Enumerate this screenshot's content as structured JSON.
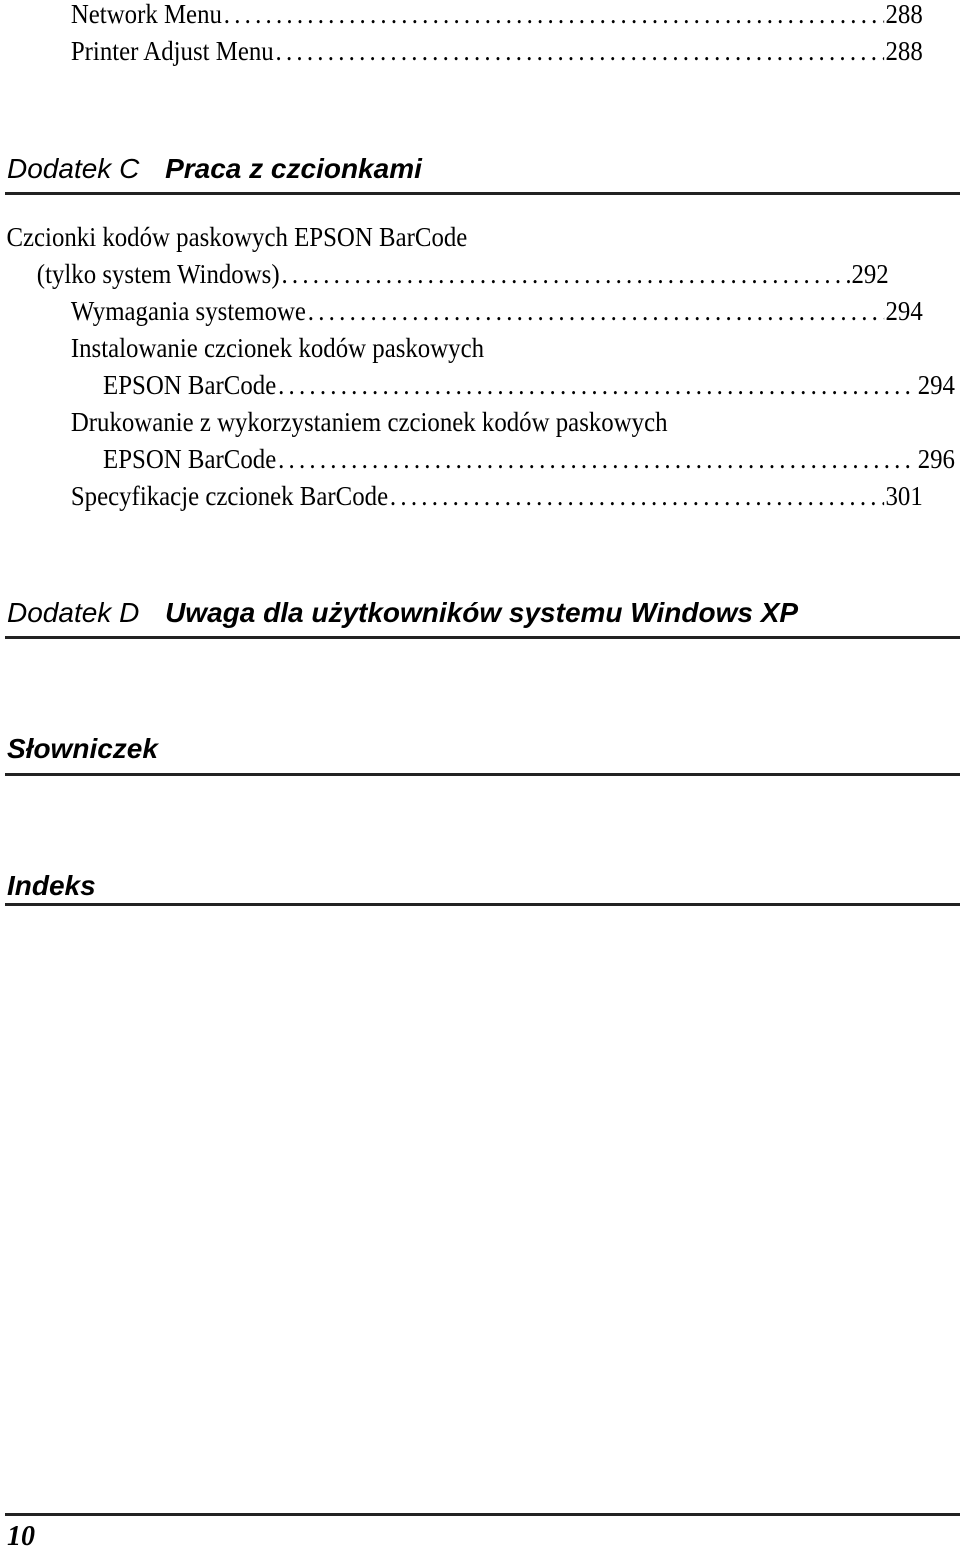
{
  "toc_top": [
    {
      "label": "Network Menu",
      "page": "288"
    },
    {
      "label": "Printer Adjust Menu",
      "page": "288"
    }
  ],
  "appendix_c": {
    "prefix": "Dodatek C",
    "title": "Praca z czcionkami",
    "entries": [
      {
        "label": "Czcionki kodów paskowych EPSON BarCode",
        "page": ""
      },
      {
        "label": "(tylko system Windows)",
        "page": "292"
      },
      {
        "label": "Wymagania systemowe",
        "page": "294"
      },
      {
        "label": "Instalowanie czcionek kodów paskowych",
        "page": ""
      },
      {
        "label": "EPSON BarCode",
        "page": "294"
      },
      {
        "label": "Drukowanie z wykorzystaniem czcionek kodów paskowych",
        "page": ""
      },
      {
        "label": "EPSON BarCode",
        "page": "296"
      },
      {
        "label": "Specyfikacje czcionek BarCode",
        "page": "301"
      }
    ]
  },
  "appendix_d": {
    "prefix": "Dodatek D",
    "title": "Uwaga dla użytkowników systemu Windows XP"
  },
  "glossary": {
    "title": "Słowniczek"
  },
  "index": {
    "title": "Indeks"
  },
  "footer": {
    "page_number": "10"
  },
  "leader": "........................................................................................................"
}
